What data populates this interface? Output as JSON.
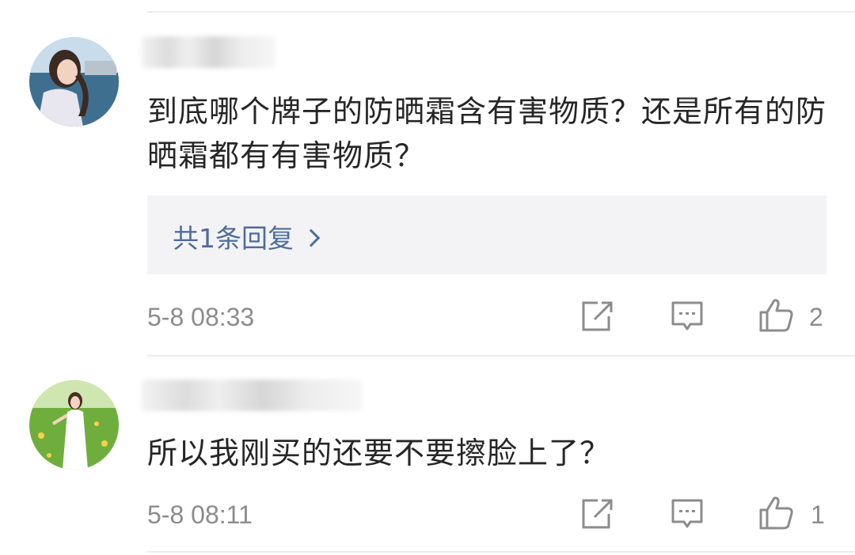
{
  "comments": [
    {
      "username": "",
      "text": "到底哪个牌子的防晒霜含有害物质？还是所有的防晒霜都有有害物质？",
      "reply_label": "共1条回复",
      "time": "5-8 08:33",
      "likes": "2"
    },
    {
      "username": "",
      "text": "所以我刚买的还要不要擦脸上了？",
      "time": "5-8 08:11",
      "likes": "1"
    }
  ],
  "colors": {
    "link": "#4e6c9d",
    "meta": "#8c8c8c",
    "reply_bg": "#f3f3f5",
    "icon": "#8c8c8c"
  },
  "icons": [
    "share-icon",
    "comment-icon",
    "like-icon"
  ]
}
